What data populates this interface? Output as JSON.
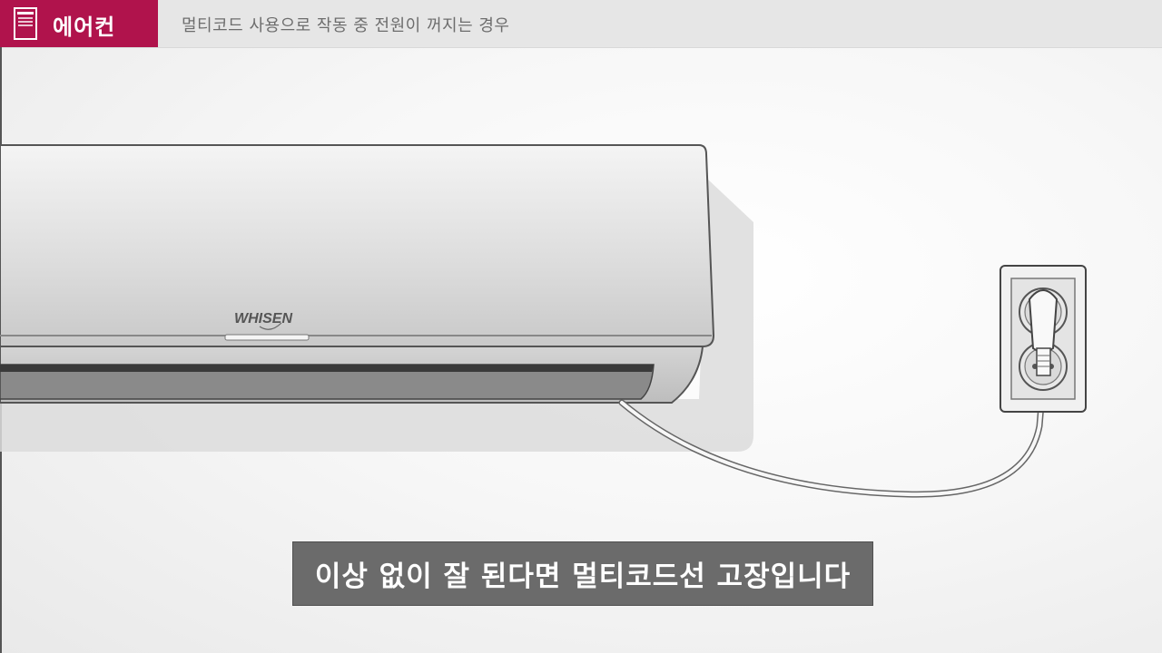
{
  "header": {
    "category_label": "에어컨",
    "category_icon": "document-icon",
    "title": "멀티코드 사용으로 작동 중 전원이 꺼지는 경우"
  },
  "illustration": {
    "brand_label": "WHISEN"
  },
  "caption": {
    "text": "이상 없이 잘 된다면 멀티코드선 고장입니다"
  },
  "colors": {
    "accent": "#b0134c",
    "header_bg": "#e6e6e6",
    "caption_bg": "#6b6b6b"
  }
}
